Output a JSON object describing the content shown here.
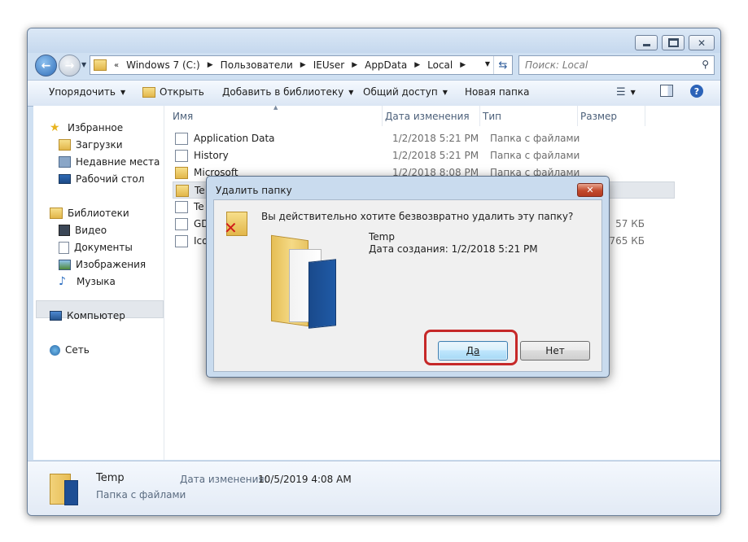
{
  "address": {
    "segments": [
      "Windows 7 (C:)",
      "Пользователи",
      "IEUser",
      "AppData",
      "Local"
    ],
    "search_placeholder": "Поиск: Local"
  },
  "toolbar": {
    "organize": "Упорядочить",
    "open": "Открыть",
    "add_to_library": "Добавить в библиотеку",
    "share": "Общий доступ",
    "new_folder": "Новая папка"
  },
  "sidebar": {
    "favorites": "Избранное",
    "downloads": "Загрузки",
    "recent": "Недавние места",
    "desktop": "Рабочий стол",
    "libraries": "Библиотеки",
    "video": "Видео",
    "documents": "Документы",
    "images": "Изображения",
    "music": "Музыка",
    "computer": "Компьютер",
    "network": "Сеть"
  },
  "columns": {
    "name": "Имя",
    "date": "Дата изменения",
    "type": "Тип",
    "size": "Размер"
  },
  "files": [
    {
      "name": "Application Data",
      "date": "1/2/2018 5:21 PM",
      "type": "Папка с файлами",
      "size": ""
    },
    {
      "name": "History",
      "date": "1/2/2018 5:21 PM",
      "type": "Папка с файлами",
      "size": ""
    },
    {
      "name": "Microsoft",
      "date": "1/2/2018 8:08 PM",
      "type": "Папка с файлами",
      "size": ""
    },
    {
      "name": "Te",
      "date": "",
      "type": "",
      "size": ""
    },
    {
      "name": "Te",
      "date": "",
      "type": "",
      "size": ""
    },
    {
      "name": "GD",
      "date": "",
      "type": "",
      "size": "57 КБ"
    },
    {
      "name": "Ico",
      "date": "",
      "type": "",
      "size": "765 КБ"
    }
  ],
  "dialog": {
    "title": "Удалить папку",
    "question": "Вы действительно хотите безвозвратно удалить эту папку?",
    "folder_name": "Temp",
    "created": "Дата создания: 1/2/2018 5:21 PM",
    "yes": "Да",
    "no": "Нет"
  },
  "details": {
    "name": "Temp",
    "modified_label": "Дата изменения:",
    "modified_value": "10/5/2019 4:08 AM",
    "type": "Папка с файлами"
  },
  "colors": {
    "highlight": "#c62828",
    "window_frame": "#cfe0f2"
  }
}
